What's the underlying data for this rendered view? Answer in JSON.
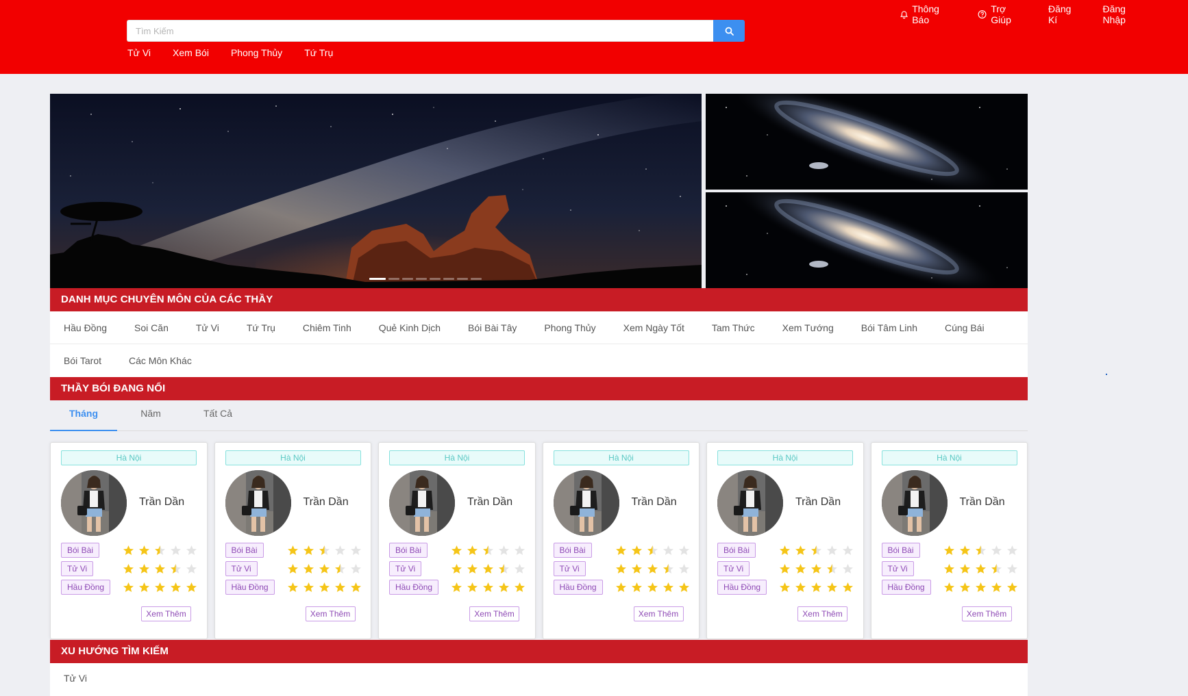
{
  "header": {
    "search_placeholder": "Tìm Kiếm",
    "nav": [
      "Tử Vi",
      "Xem Bói",
      "Phong Thủy",
      "Tứ Trụ"
    ],
    "right_menu": {
      "notifications": "Thông Báo",
      "help": "Trợ Giúp",
      "register": "Đăng Kí",
      "login": "Đăng Nhập"
    }
  },
  "banner": {
    "slide_count": 8,
    "active_slide": 1
  },
  "categories": {
    "title": "DANH MỤC CHUYÊN MÔN CỦA CÁC THẦY",
    "row1": [
      "Hầu Đồng",
      "Soi Căn",
      "Tử Vi",
      "Tứ Trụ",
      "Chiêm Tinh",
      "Quẻ Kinh Dịch",
      "Bói Bài Tây",
      "Phong Thủy",
      "Xem Ngày Tốt",
      "Tam Thức",
      "Xem Tướng",
      "Bói Tâm Linh",
      "Cúng Bái"
    ],
    "row2": [
      "Bói Tarot",
      "Các Môn Khác"
    ]
  },
  "featured": {
    "title": "THẦY BÓI ĐANG NỔI",
    "tabs": [
      "Tháng",
      "Năm",
      "Tất Cả"
    ],
    "active_tab": "Tháng",
    "more_label": "Xem Thêm",
    "cards": [
      {
        "location": "Hà Nội",
        "name": "Trần Dần",
        "skills": [
          {
            "label": "Bói Bài",
            "rating": 2.5
          },
          {
            "label": "Tử Vi",
            "rating": 3.5
          },
          {
            "label": "Hầu Đồng",
            "rating": 5
          }
        ]
      },
      {
        "location": "Hà Nội",
        "name": "Trần Dần",
        "skills": [
          {
            "label": "Bói Bài",
            "rating": 2.5
          },
          {
            "label": "Tử Vi",
            "rating": 3.5
          },
          {
            "label": "Hầu Đồng",
            "rating": 5
          }
        ]
      },
      {
        "location": "Hà Nội",
        "name": "Trần Dần",
        "skills": [
          {
            "label": "Bói Bài",
            "rating": 2.5
          },
          {
            "label": "Tử Vi",
            "rating": 3.5
          },
          {
            "label": "Hầu Đồng",
            "rating": 5
          }
        ]
      },
      {
        "location": "Hà Nội",
        "name": "Trần Dần",
        "skills": [
          {
            "label": "Bói Bài",
            "rating": 2.5
          },
          {
            "label": "Tử Vi",
            "rating": 3.5
          },
          {
            "label": "Hầu Đồng",
            "rating": 5
          }
        ]
      },
      {
        "location": "Hà Nội",
        "name": "Trần Dần",
        "skills": [
          {
            "label": "Bói Bài",
            "rating": 2.5
          },
          {
            "label": "Tử Vi",
            "rating": 3.5
          },
          {
            "label": "Hầu Đồng",
            "rating": 5
          }
        ]
      },
      {
        "location": "Hà Nội",
        "name": "Trần Dần",
        "skills": [
          {
            "label": "Bói Bài",
            "rating": 2.5
          },
          {
            "label": "Tử Vi",
            "rating": 3.5
          },
          {
            "label": "Hầu Đồng",
            "rating": 5
          }
        ]
      }
    ]
  },
  "trends": {
    "title": "XU HƯỚNG TÌM KIẾM",
    "first_item": "Tử Vi"
  },
  "colors": {
    "header_red": "#f20000",
    "section_red": "#c81c25",
    "accent_blue": "#3c8ff0",
    "star_gold": "#f5c518",
    "star_empty": "#e3e3e3"
  },
  "icons": {
    "search": "search-icon",
    "notifications": "bell-icon",
    "help": "question-circle-icon",
    "star": "star-icon"
  }
}
